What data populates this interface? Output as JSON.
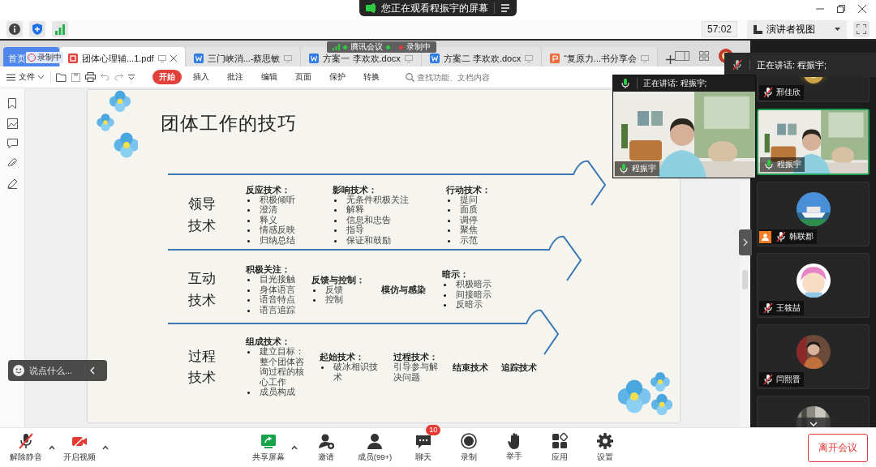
{
  "top_bar": {
    "notice": "您正在观看程振宇的屏幕"
  },
  "meeting_toolbar": {
    "timer": "57:02",
    "view_button": "演讲者视图"
  },
  "recording_overlay": {
    "app": "腾讯会议",
    "status": "录制中"
  },
  "document_window": {
    "tabs": [
      {
        "label": "首页",
        "kind": "home",
        "selected": false
      },
      {
        "label": "团体心理辅...1.pdf",
        "kind": "pdf",
        "selected": true
      },
      {
        "label": "三门峡消...-蔡思敏",
        "kind": "word",
        "selected": false
      },
      {
        "label": "方案一 李欢欢.docx",
        "kind": "word",
        "selected": false
      },
      {
        "label": "方案二 李欢欢.docx",
        "kind": "word",
        "selected": false
      },
      {
        "label": "“复原力...书分享会",
        "kind": "ppt",
        "selected": false
      }
    ],
    "home_tab_badge": "录制中",
    "menu": "文件",
    "ribbon_tabs": [
      {
        "label": "开始",
        "selected": true
      },
      {
        "label": "插入",
        "selected": false
      },
      {
        "label": "批注",
        "selected": false
      },
      {
        "label": "编辑",
        "selected": false
      },
      {
        "label": "页面",
        "selected": false
      },
      {
        "label": "保护",
        "selected": false
      },
      {
        "label": "转换",
        "selected": false
      }
    ],
    "search": {
      "placeholder": "查找功能、文档内容"
    },
    "slide": {
      "title": "团体工作的技巧",
      "sections": [
        {
          "label": "领导技术",
          "groups": [
            {
              "heading": "反应技术：",
              "items": [
                "积极倾听",
                "澄清",
                "释义",
                "情感反映",
                "归纳总结"
              ]
            },
            {
              "heading": "影响技术：",
              "items": [
                "无条件积极关注",
                "解释",
                "信息和忠告",
                "指导",
                "保证和鼓励"
              ]
            },
            {
              "heading": "行动技术：",
              "items": [
                "提问",
                "面质",
                "调停",
                "聚焦",
                "示范"
              ]
            }
          ]
        },
        {
          "label": "互动技术",
          "groups": [
            {
              "heading": "积极关注：",
              "items": [
                "目光接触",
                "身体语言",
                "语音特点",
                "语言追踪"
              ]
            },
            {
              "heading": "反馈与控制：",
              "items": [
                "反馈",
                "控制"
              ]
            },
            {
              "heading": "模仿与感染"
            },
            {
              "heading": "暗示：",
              "items": [
                "积极暗示",
                "间接暗示",
                "反暗示"
              ]
            }
          ]
        },
        {
          "label": "过程技术",
          "groups": [
            {
              "heading": "组成技术：",
              "items": [
                "建立目标：整个团体咨询过程的核心工作",
                "成员构成"
              ]
            },
            {
              "heading": "起始技术：",
              "items": [
                "破冰相识技术"
              ]
            },
            {
              "heading": "过程技术：",
              "body": "引导参与解决问题"
            },
            {
              "heading": "结束技术"
            },
            {
              "heading": "追踪技术"
            }
          ]
        }
      ]
    }
  },
  "speaking_banner": "正在讲话: 程振宇;",
  "speaker_video": {
    "banner": "正在讲话: 程振宇;",
    "name": "程振宇"
  },
  "chat_input": {
    "placeholder": "说点什么..."
  },
  "participants": [
    {
      "name": "邢佳欣",
      "muted": true,
      "speaking": false,
      "tagged": false,
      "kind": "gold"
    },
    {
      "name": "程振宇",
      "muted": false,
      "speaking": true,
      "tagged": false,
      "kind": "video"
    },
    {
      "name": "韩联郡",
      "muted": true,
      "speaking": false,
      "tagged": true,
      "kind": "ship"
    },
    {
      "name": "王筱喆",
      "muted": true,
      "speaking": false,
      "tagged": false,
      "kind": "cartoon"
    },
    {
      "name": "闫熙晋",
      "muted": true,
      "speaking": false,
      "tagged": false,
      "kind": "portrait"
    },
    {
      "kind": "street"
    }
  ],
  "bottom_bar": {
    "controls": [
      {
        "label": "解除静音",
        "kind": "mic_off",
        "caret": true
      },
      {
        "label": "开启视频",
        "kind": "camera_off",
        "caret": true
      },
      {
        "label": "共享屏幕",
        "kind": "share",
        "caret": true
      },
      {
        "label": "邀请",
        "kind": "invite",
        "caret": false
      },
      {
        "label": "成员(99+)",
        "kind": "members",
        "caret": false
      },
      {
        "label": "聊天",
        "kind": "chat",
        "caret": false,
        "badge": "10"
      },
      {
        "label": "录制",
        "kind": "record",
        "caret": false
      },
      {
        "label": "举手",
        "kind": "hand",
        "caret": false
      },
      {
        "label": "应用",
        "kind": "apps",
        "caret": false
      },
      {
        "label": "设置",
        "kind": "settings",
        "caret": false
      }
    ],
    "leave_button": "离开会议"
  }
}
